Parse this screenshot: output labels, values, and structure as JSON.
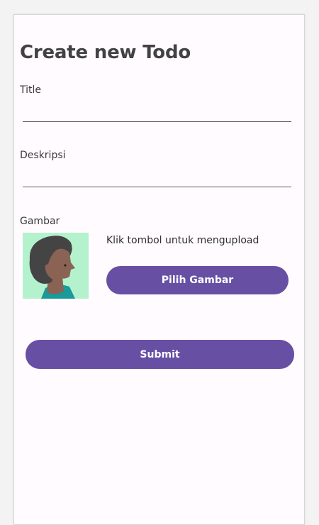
{
  "page": {
    "title": "Create new Todo"
  },
  "form": {
    "title_label": "Title",
    "title_value": "",
    "description_label": "Deskripsi",
    "description_value": "",
    "image_label": "Gambar",
    "image_hint": "Klik tombol untuk mengupload",
    "image_icon": "avatar-placeholder",
    "pick_image_label": "Pilih Gambar",
    "submit_label": "Submit"
  },
  "colors": {
    "primary": "#6750a4",
    "background": "#fffbfe",
    "avatar_background": "#b3f2cd"
  }
}
